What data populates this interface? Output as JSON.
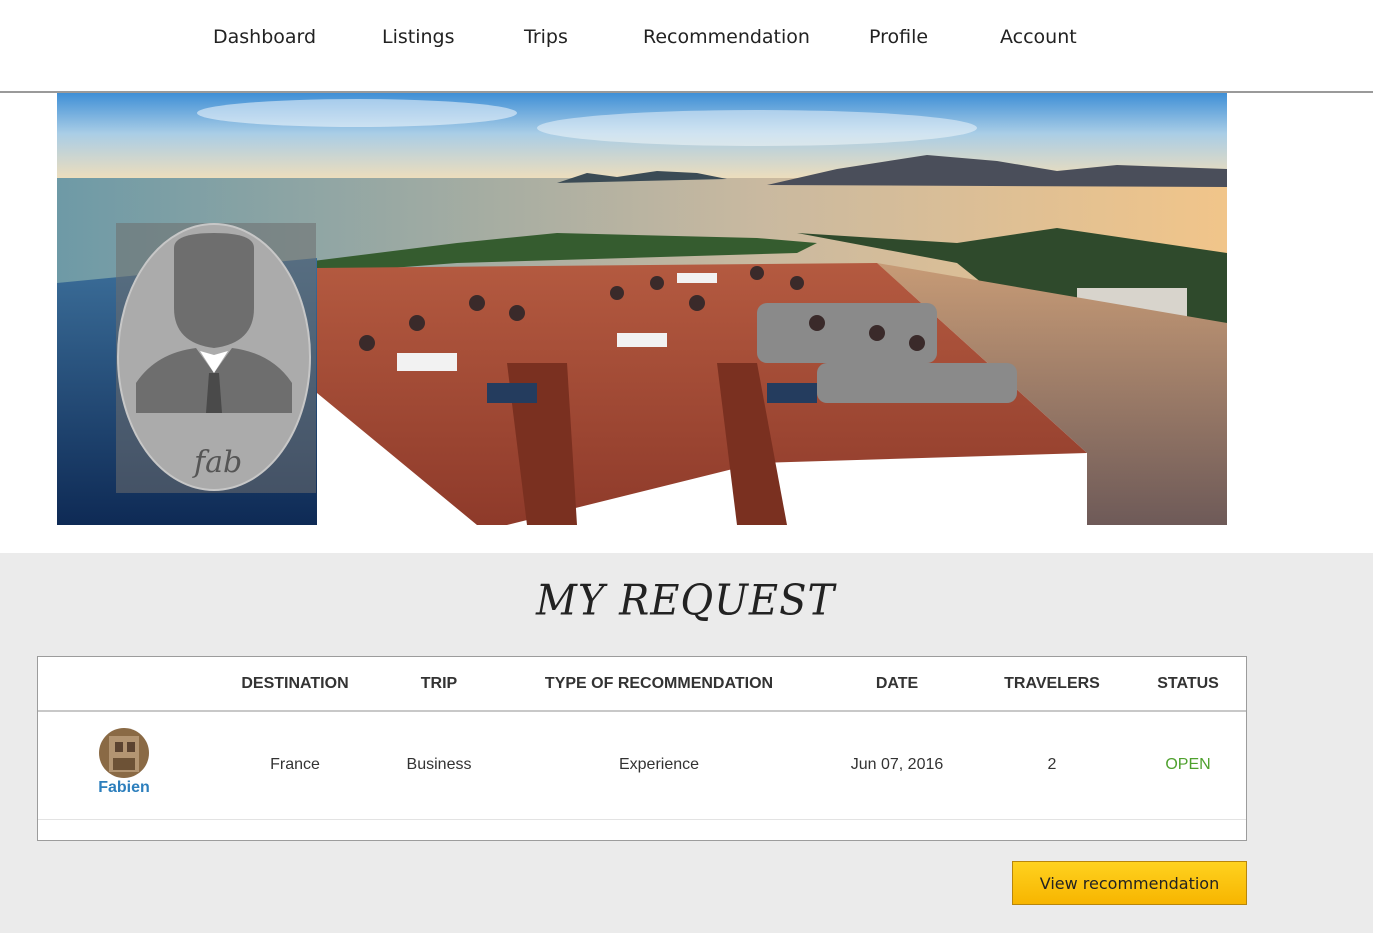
{
  "nav": {
    "items": [
      "Dashboard",
      "Listings",
      "Trips",
      "Recommendation",
      "Profile",
      "Account"
    ]
  },
  "hero": {
    "image": "rooftop-infinity-pool-sea-view",
    "profile_signature": "fab"
  },
  "section": {
    "title": "MY REQUEST"
  },
  "table": {
    "columns": [
      "DESTINATION",
      "TRIP",
      "TYPE OF RECOMMENDATION",
      "DATE",
      "TRAVELERS",
      "STATUS"
    ],
    "rows": [
      {
        "user": "Fabien",
        "destination": "France",
        "trip": "Business",
        "type": "Experience",
        "date": "Jun 07, 2016",
        "travelers": "2",
        "status": "OPEN"
      }
    ]
  },
  "actions": {
    "view_label": "View recommendation"
  },
  "colors": {
    "status_open": "#4fa12e",
    "user_link": "#2d7fbd",
    "button": "#f9c20f"
  }
}
